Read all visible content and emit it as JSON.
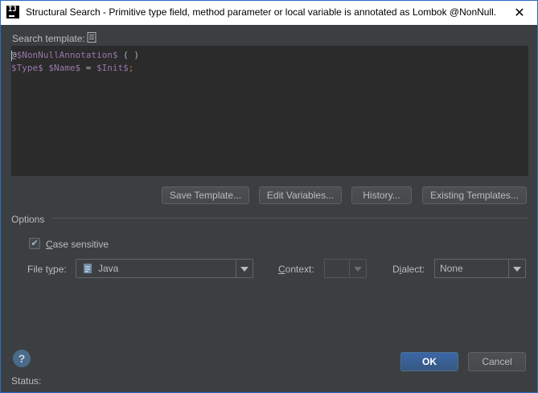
{
  "window": {
    "title": "Structural Search - Primitive type field, method parameter or local variable is annotated as Lombok @NonNull.",
    "close_glyph": "✕"
  },
  "search_template": {
    "label": "Search template:",
    "code_lines": [
      [
        {
          "t": "@",
          "c": "p"
        },
        {
          "t": "$NonNullAnnotation$",
          "c": "v"
        },
        {
          "t": " ( )",
          "c": "p"
        }
      ],
      [
        {
          "t": "$Type$",
          "c": "v"
        },
        {
          "t": " ",
          "c": "p"
        },
        {
          "t": "$Name$",
          "c": "v"
        },
        {
          "t": " = ",
          "c": "p"
        },
        {
          "t": "$Init$",
          "c": "v"
        },
        {
          "t": ";",
          "c": "k"
        }
      ]
    ]
  },
  "buttons": {
    "save_template": "Save Template...",
    "edit_variables": "Edit Variables...",
    "history": "History...",
    "existing_templates": "Existing Templates..."
  },
  "options": {
    "section_label": "Options",
    "case_sensitive": {
      "label": "Case sensitive",
      "checked": true,
      "mnemonic": "C",
      "rest": "ase sensitive"
    },
    "file_type": {
      "label_pre": "File t",
      "label_mn": "y",
      "label_post": "pe:",
      "value": "Java",
      "icon": "java-file-icon"
    },
    "context": {
      "label_pre": "",
      "label_mn": "C",
      "label_post": "ontext:",
      "value": ""
    },
    "dialect": {
      "label_pre": "D",
      "label_mn": "i",
      "label_post": "alect:",
      "value": "None"
    }
  },
  "footer": {
    "help_glyph": "?",
    "ok": "OK",
    "cancel": "Cancel",
    "status_label": "Status:"
  },
  "colors": {
    "accent": "#365880",
    "background": "#3c3f41",
    "editor_background": "#2b2b2b",
    "template_variable": "#9876aa"
  }
}
